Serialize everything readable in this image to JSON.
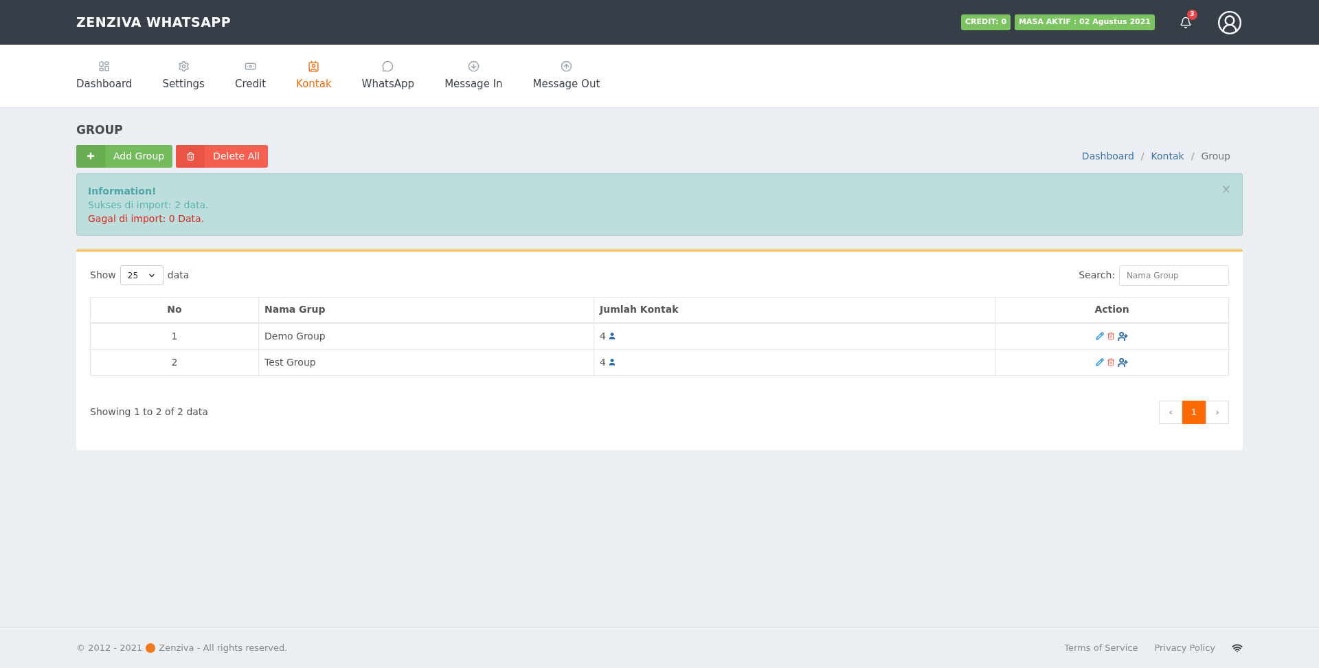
{
  "header": {
    "brand": "ZENZIVA WHATSAPP",
    "badges": [
      "CREDIT: 0",
      "MASA AKTIF : 02 Agustus 2021"
    ],
    "notification_count": "3"
  },
  "nav": [
    {
      "kind": "dashboard",
      "label": "Dashboard",
      "selected": false
    },
    {
      "kind": "settings",
      "label": "Settings",
      "selected": false
    },
    {
      "kind": "credit",
      "label": "Credit",
      "selected": false
    },
    {
      "kind": "contact",
      "label": "Kontak",
      "selected": true
    },
    {
      "kind": "whatsapp",
      "label": "WhatsApp",
      "selected": false
    },
    {
      "kind": "in",
      "label": "Message In",
      "selected": false
    },
    {
      "kind": "out",
      "label": "Message Out",
      "selected": false
    }
  ],
  "page_title": "GROUP",
  "buttons": [
    {
      "kind": "add",
      "label": "Add Group"
    },
    {
      "kind": "delete",
      "label": "Delete All"
    }
  ],
  "breadcrumb": [
    {
      "label": "Dashboard",
      "link": true
    },
    {
      "separator": "/",
      "label": "Kontak",
      "link": true
    },
    {
      "separator": "/",
      "label": "Group",
      "link": false
    }
  ],
  "alert": {
    "title": "Information!",
    "success": "Sukses di import: 2 data.",
    "failure": "Gagal di import: 0 Data.",
    "close": "×"
  },
  "table": {
    "show_label": "Show",
    "page_size": "25",
    "data_label": "data",
    "search_label": "Search:",
    "search_placeholder": "Nama Group",
    "columns": [
      "No",
      "Nama Grup",
      "Jumlah Kontak",
      "Action"
    ],
    "rows": [
      {
        "no": "1",
        "name": "Demo Group",
        "count": "4"
      },
      {
        "no": "2",
        "name": "Test Group",
        "count": "4"
      }
    ],
    "summary": "Showing 1 to 2 of 2 data",
    "pagination": [
      {
        "label": "‹",
        "selected": false
      },
      {
        "label": "1",
        "selected": true
      },
      {
        "label": "›",
        "selected": false
      }
    ]
  },
  "footer": {
    "copyright": "© 2012 - 2021",
    "brand": "Zenziva - All rights reserved.",
    "links": [
      "Terms of Service",
      "Privacy Policy"
    ]
  }
}
